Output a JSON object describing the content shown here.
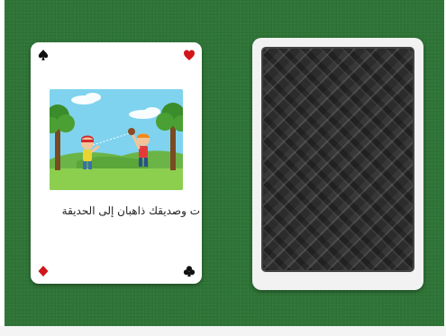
{
  "game": {
    "table_color": "#2f7537",
    "cards": [
      {
        "state": "face-up",
        "suits": {
          "top_left": "spade",
          "top_right": "heart",
          "bottom_left": "diamond",
          "bottom_right": "club"
        },
        "suit_colors": {
          "red": "#d0161b",
          "black": "#111111"
        },
        "illustration": "two-children-playing-in-park",
        "text": "ت وصديقك ذاهبان إلى الحديقة"
      },
      {
        "state": "face-down",
        "back_pattern": "dark-argyle"
      }
    ]
  }
}
